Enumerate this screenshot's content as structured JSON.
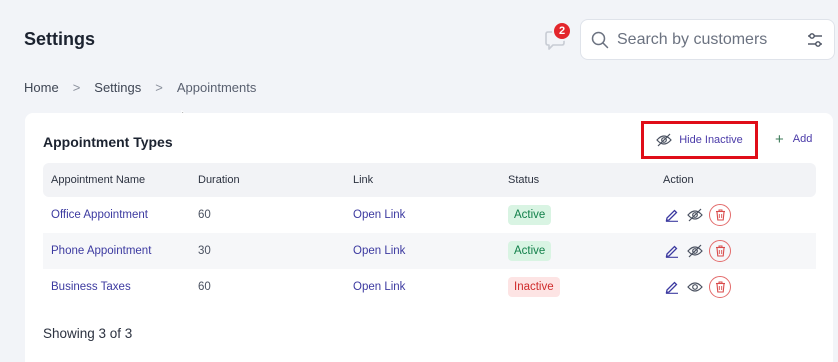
{
  "header": {
    "title": "Settings",
    "notification_count": "2",
    "search_placeholder": "Search by customers"
  },
  "breadcrumb": {
    "items": [
      "Home",
      "Settings",
      "Appointments"
    ],
    "separator": ">"
  },
  "card": {
    "title": "Appointment Types",
    "hide_inactive_label": "Hide Inactive",
    "add_label": "Add"
  },
  "table": {
    "columns": [
      "Appointment Name",
      "Duration",
      "Link",
      "Status",
      "Action"
    ],
    "rows": [
      {
        "name": "Office Appointment",
        "duration": "60",
        "link": "Open Link",
        "status": "Active"
      },
      {
        "name": "Phone Appointment",
        "duration": "30",
        "link": "Open Link",
        "status": "Active"
      },
      {
        "name": "Business Taxes",
        "duration": "60",
        "link": "Open Link",
        "status": "Inactive"
      }
    ]
  },
  "footer": {
    "count_text": "Showing 3 of 3"
  },
  "colors": {
    "accent": "#3c3aa0",
    "active_bg": "#d9f4e3",
    "active_text": "#12804a",
    "inactive_bg": "#fde4e4",
    "inactive_text": "#cf2a2a",
    "highlight_border": "#e00d18",
    "notification_badge": "#e3262c"
  },
  "icons": {
    "notification": "message-icon",
    "search": "search-icon",
    "filter": "filter-sliders-icon",
    "hide": "eye-off-icon",
    "add": "plus-icon",
    "edit": "pencil-icon",
    "toggle_active": "eye-off-icon",
    "toggle_inactive": "eye-icon",
    "delete": "trash-icon"
  }
}
